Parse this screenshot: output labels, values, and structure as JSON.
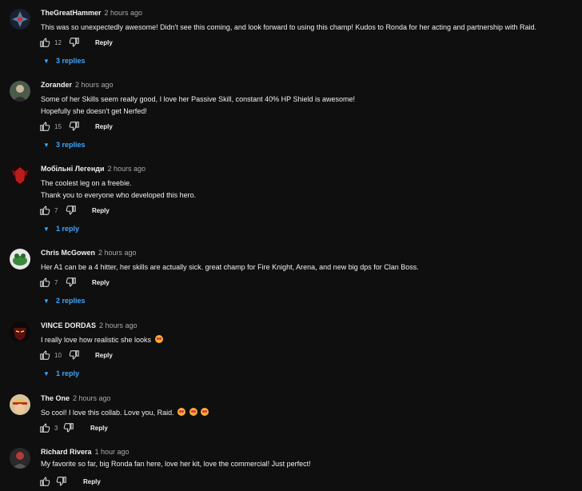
{
  "comments": [
    {
      "author": "TheGreatHammer",
      "time": "2 hours ago",
      "lines": [
        "This was so unexpectedly awesome! Didn't see this coming, and look forward to using this champ! Kudos to Ronda for her acting and partnership with Raid."
      ],
      "likes": "12",
      "reply_label": "Reply",
      "replies": "3 replies"
    },
    {
      "author": "Zorander",
      "time": "2 hours ago",
      "lines": [
        "Some of her Skills seem really good, I love her Passive Skill, constant 40% HP Shield is awesome!",
        "Hopefully she doesn't get Nerfed!"
      ],
      "likes": "15",
      "reply_label": "Reply",
      "replies": "3 replies"
    },
    {
      "author": "Мобільні Легенди",
      "time": "2 hours ago",
      "lines": [
        "The coolest leg on a freebie.",
        "Thank you to everyone who developed this hero."
      ],
      "likes": "7",
      "reply_label": "Reply",
      "replies": "1 reply"
    },
    {
      "author": "Chris McGowen",
      "time": "2 hours ago",
      "lines": [
        "Her A1 can be a 4 hitter, her skills are actually sick. great champ for Fire Knight, Arena, and new big dps for Clan Boss."
      ],
      "likes": "7",
      "reply_label": "Reply",
      "replies": "2 replies"
    },
    {
      "author": "VINCE DORDAS",
      "time": "2 hours ago",
      "lines": [
        "I really love how realistic she looks"
      ],
      "likes": "10",
      "reply_label": "Reply",
      "replies": "1 reply"
    },
    {
      "author": "The One",
      "time": "2 hours ago",
      "lines": [
        "So cool! I love this collab. Love you, Raid."
      ],
      "likes": "3",
      "reply_label": "Reply",
      "replies": ""
    },
    {
      "author": "Richard Rivera",
      "time": "1 hour ago",
      "lines": [
        "My favorite so far, big Ronda fan here, love her kit, love the commercial! Just perfect!"
      ],
      "likes": "",
      "reply_label": "Reply",
      "replies": ""
    }
  ],
  "icons": {
    "like": "thumbs-up-icon",
    "dislike": "thumbs-down-icon",
    "expand": "chevron-down-icon"
  },
  "colors": {
    "background": "#0f0f0f",
    "text": "#f1f1f1",
    "secondary": "#aaaaaa",
    "link": "#3ea6ff"
  }
}
